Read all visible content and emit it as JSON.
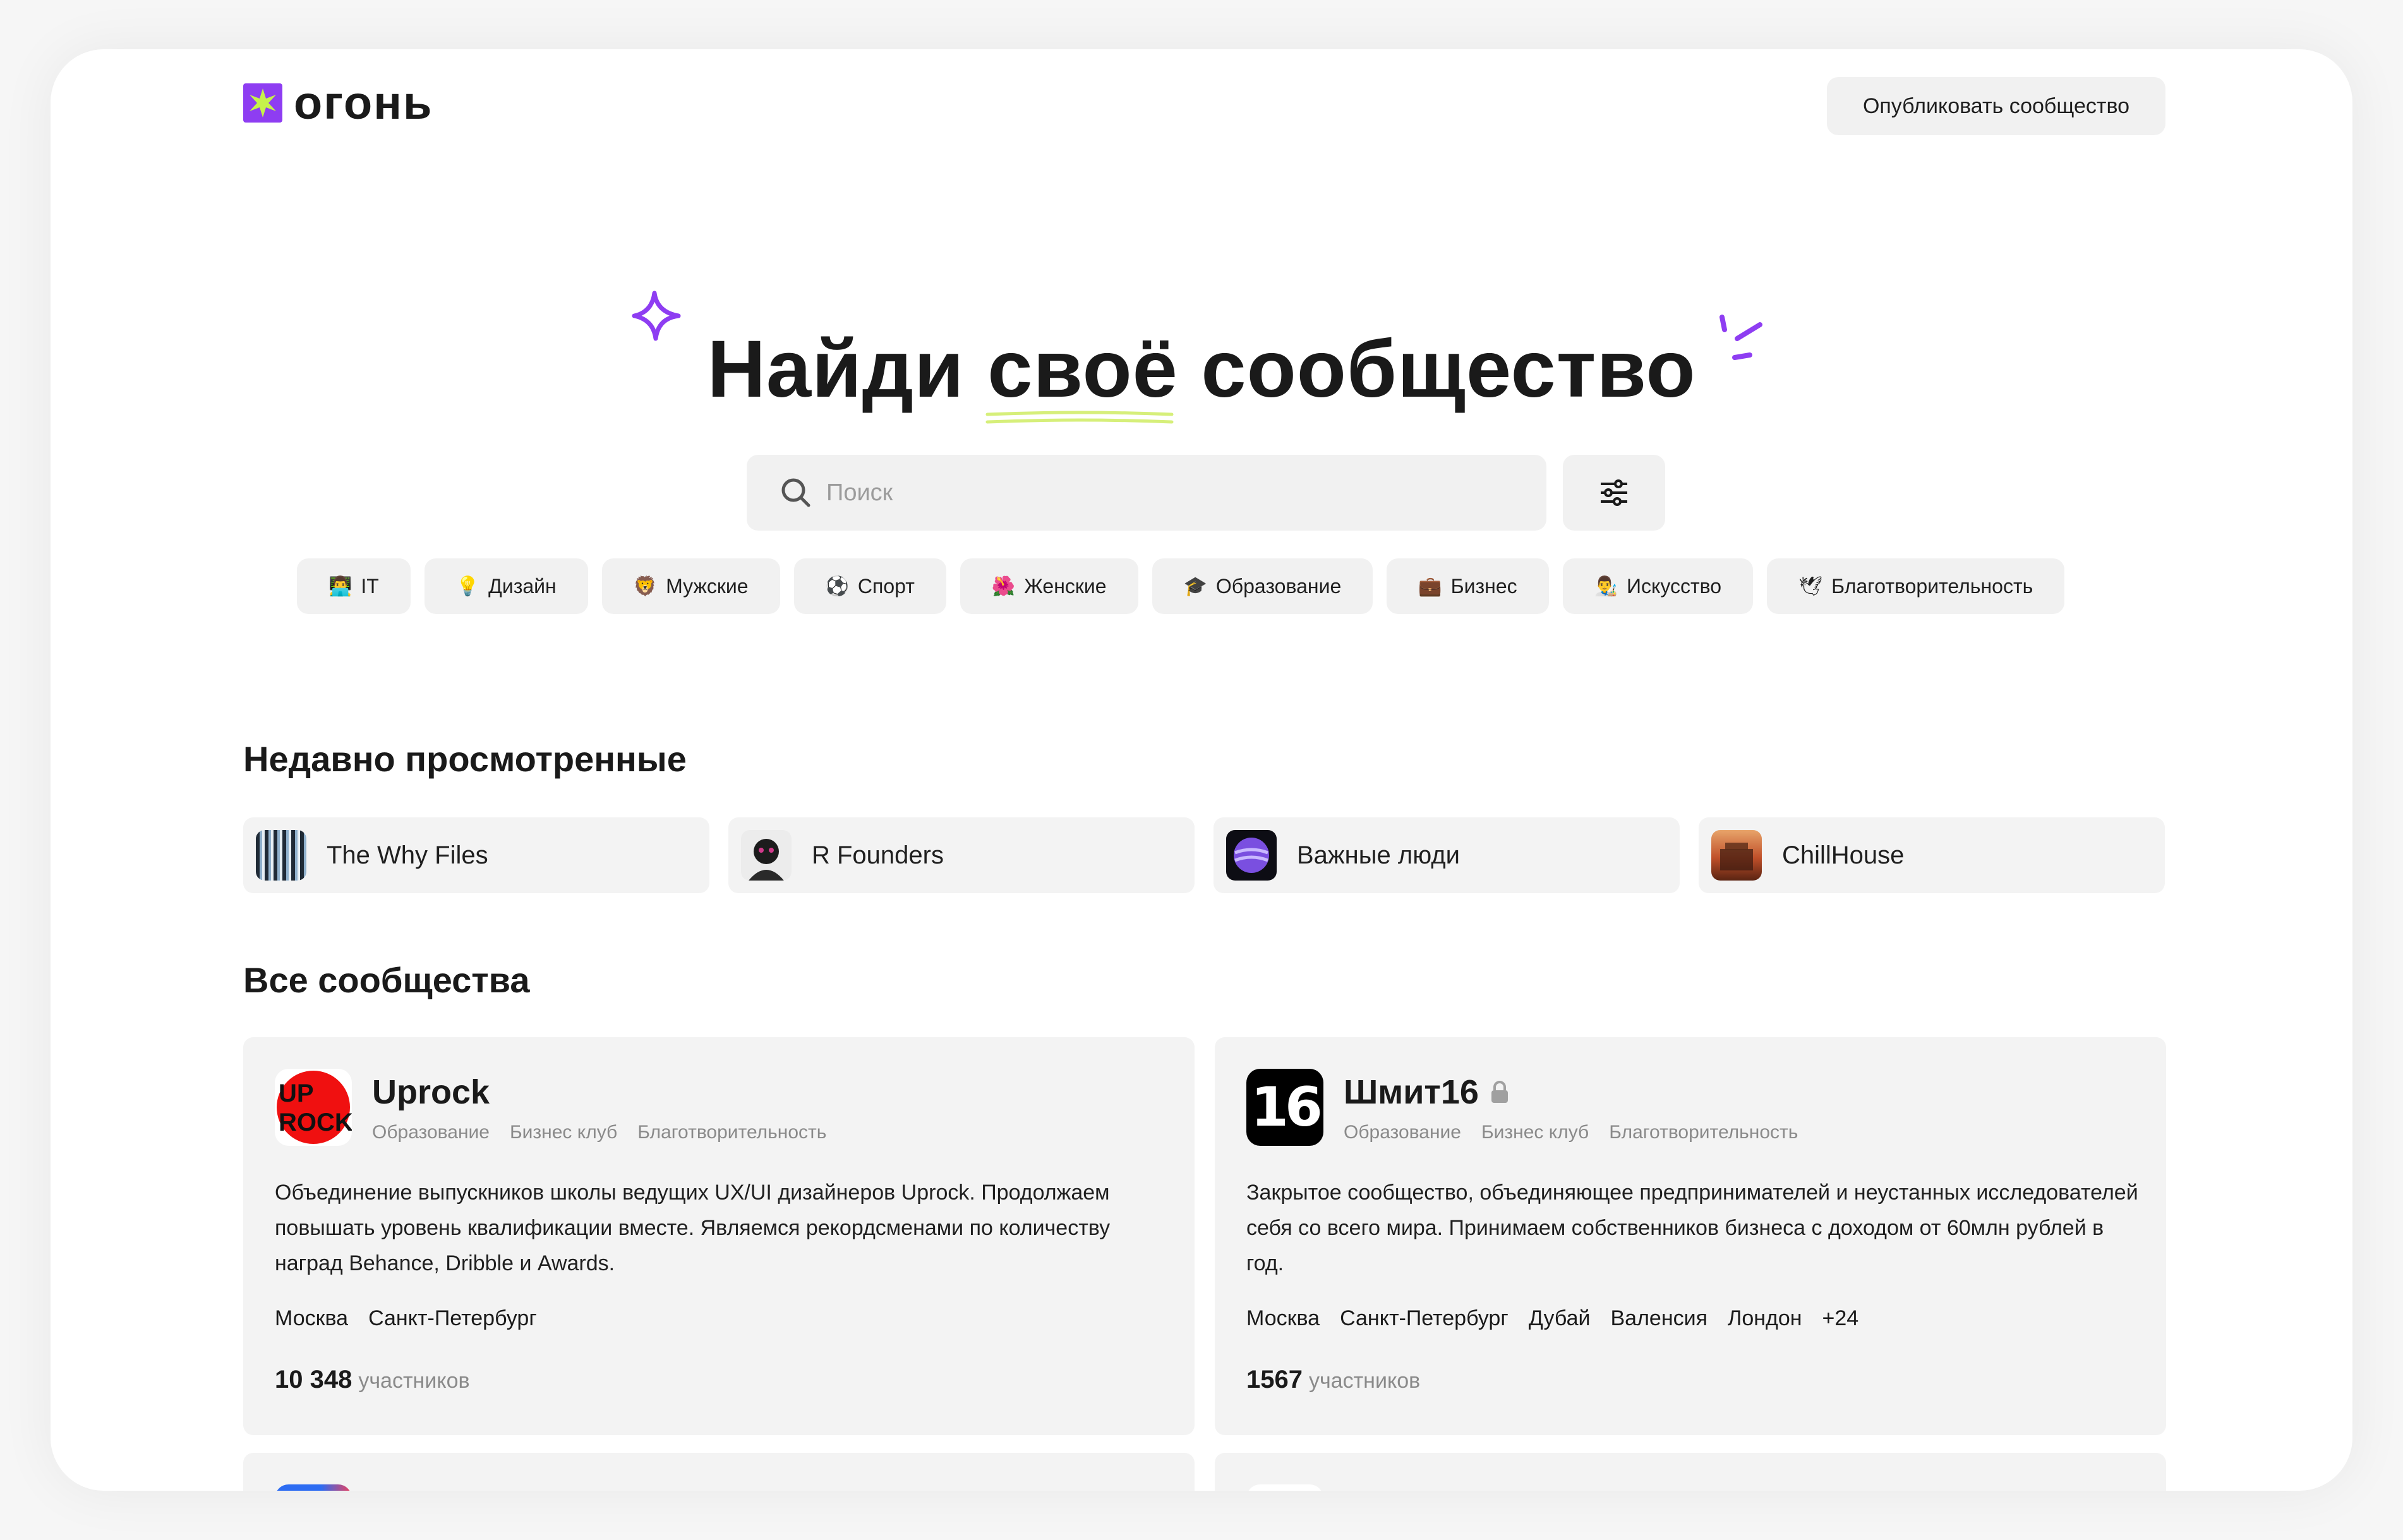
{
  "header": {
    "logo_text": "огонь",
    "publish_button": "Опубликовать сообщество"
  },
  "hero": {
    "title_before": "Найди ",
    "title_highlight": "своё",
    "title_after": " сообщество"
  },
  "search": {
    "placeholder": "Поиск"
  },
  "categories": [
    {
      "emoji": "👨‍💻",
      "label": "IT"
    },
    {
      "emoji": "💡",
      "label": "Дизайн"
    },
    {
      "emoji": "🦁",
      "label": "Мужские"
    },
    {
      "emoji": "⚽",
      "label": "Спорт"
    },
    {
      "emoji": "🌺",
      "label": "Женские"
    },
    {
      "emoji": "🎓",
      "label": "Образование"
    },
    {
      "emoji": "💼",
      "label": "Бизнес"
    },
    {
      "emoji": "👨‍🎨",
      "label": "Искусство"
    },
    {
      "emoji": "🕊",
      "label": "Благотворительность"
    }
  ],
  "recent": {
    "title": "Недавно просмотренные",
    "items": [
      {
        "name": "The Why Files"
      },
      {
        "name": "R Founders"
      },
      {
        "name": "Важные люди"
      },
      {
        "name": "ChillHouse"
      }
    ]
  },
  "all": {
    "title": "Все сообщества",
    "communities": [
      {
        "name": "Uprock",
        "logo_text": "UP ROCK",
        "tags": [
          "Образование",
          "Бизнес клуб",
          "Благотворительность"
        ],
        "description": "Объединение выпускников школы ведущих UX/UI дизайнеров Uprock. Продолжаем повышать уровень квалификации вместе. Являемся рекордсменами по количеству наград Behance, Dribble и Awards.",
        "cities": [
          "Москва",
          "Санкт-Петербург"
        ],
        "members_count": "10 348",
        "members_label": "участников"
      },
      {
        "name": "Шмит16",
        "logo_text": "16",
        "locked": true,
        "tags": [
          "Образование",
          "Бизнес клуб",
          "Благотворительность"
        ],
        "description": "Закрытое сообщество, объединяющее предпринимателей и неустанных исследователей себя со всего мира. Принимаем собственников бизнеса с доходом от 60млн рублей в год.",
        "cities": [
          "Москва",
          "Санкт-Петербург",
          "Дубай",
          "Валенсия",
          "Лондон",
          "+24"
        ],
        "members_count": "1567",
        "members_label": "участников"
      }
    ]
  },
  "colors": {
    "brand_purple": "#8e3df2",
    "brand_lime": "#c6f24a",
    "underline_lime": "#d6ef7a",
    "card_bg": "#f3f3f3",
    "uprock_red": "#f01010"
  }
}
